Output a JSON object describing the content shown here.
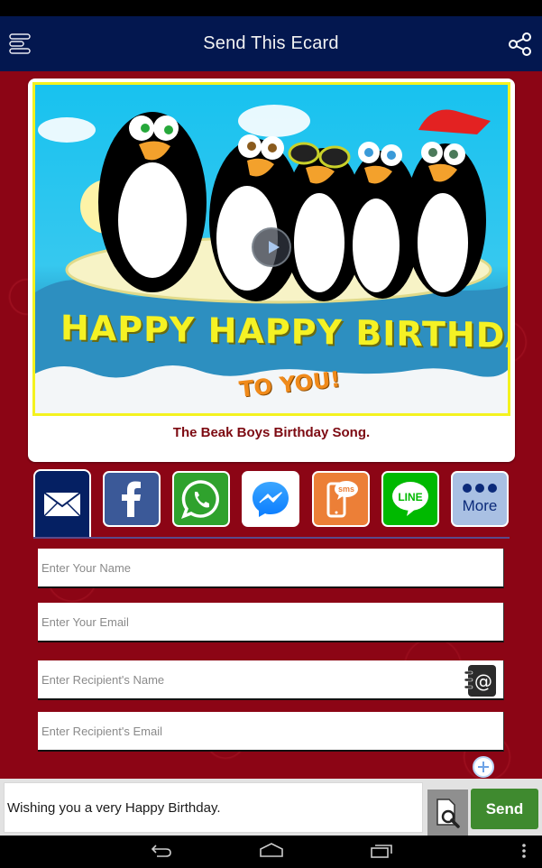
{
  "app_bar": {
    "title": "Send This Ecard",
    "menu_icon": "hamburger-menu-icon",
    "share_icon": "share-icon"
  },
  "ecard": {
    "image_text_line1": "HAPPY HAPPY BIRTHDAY",
    "image_text_line2": "TO YOU!",
    "caption": "The Beak Boys Birthday Song.",
    "play_icon": "play-icon"
  },
  "share_options": [
    {
      "id": "email",
      "label": "Email",
      "icon": "envelope-icon",
      "color": "#052063",
      "active": true
    },
    {
      "id": "facebook",
      "label": "Facebook",
      "icon": "facebook-icon",
      "color": "#3b5998",
      "active": false
    },
    {
      "id": "whatsapp",
      "label": "WhatsApp",
      "icon": "whatsapp-icon",
      "color": "#2fa22d",
      "active": false
    },
    {
      "id": "messenger",
      "label": "Messenger",
      "icon": "messenger-icon",
      "color": "#ffffff",
      "active": false
    },
    {
      "id": "sms",
      "label": "SMS",
      "icon": "sms-icon",
      "color": "#ec7f37",
      "active": false,
      "badge": "sms"
    },
    {
      "id": "line",
      "label": "LINE",
      "icon": "line-icon",
      "color": "#00b900",
      "active": false,
      "badge": "LINE"
    },
    {
      "id": "more",
      "label": "More",
      "icon": "more-dots-icon",
      "color": "#a9c0e3",
      "active": false
    }
  ],
  "form": {
    "your_name": {
      "placeholder": "Enter Your Name",
      "value": ""
    },
    "your_email": {
      "placeholder": "Enter Your Email",
      "value": ""
    },
    "recipient_name": {
      "placeholder": "Enter Recipient's Name",
      "value": ""
    },
    "recipient_email": {
      "placeholder": "Enter Recipient's Email",
      "value": ""
    },
    "contacts_icon": "address-book-icon",
    "add_recipient_icon": "add-circle-icon"
  },
  "compose": {
    "message": "Wishing you a very Happy Birthday.",
    "preview_icon": "preview-document-icon",
    "send_label": "Send"
  },
  "colors": {
    "app_bar": "#03174f",
    "background": "#8c0515",
    "caption": "#7d0a12",
    "send": "#3f8a2f"
  }
}
